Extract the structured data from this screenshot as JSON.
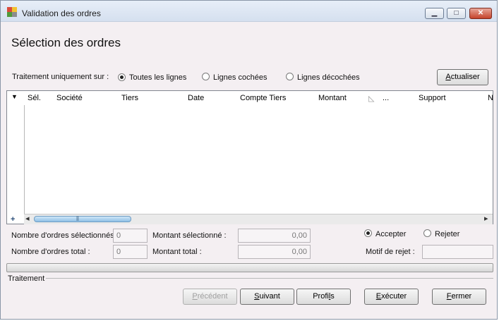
{
  "window": {
    "title": "Validation des ordres",
    "controls": {
      "minimize": "▁",
      "maximize": "□",
      "close": "✕"
    },
    "icon_colors": [
      "#d94b3b",
      "#f2c230",
      "#4f9a3b",
      "#8c8c8c"
    ]
  },
  "page": {
    "heading": "Sélection des ordres"
  },
  "filter": {
    "label": "Traitement uniquement sur :",
    "options": [
      {
        "label": "Toutes les lignes",
        "selected": true
      },
      {
        "label": "Lignes cochées",
        "selected": false
      },
      {
        "label": "Lignes décochées",
        "selected": false
      }
    ],
    "refresh": {
      "pre": "",
      "mnemonic": "A",
      "post": "ctualiser"
    }
  },
  "grid": {
    "menu_glyph": "▼",
    "columns": [
      "Sél.",
      "Société",
      "Tiers",
      "Date",
      "Compte Tiers",
      "Montant",
      "...",
      "Support",
      "N"
    ],
    "sort_glyph": "◺",
    "add_glyph": "+",
    "left_glyph": "◂",
    "right_glyph": "▸",
    "thumb_grip": "⦀"
  },
  "summary": {
    "selected_count": {
      "label": "Nombre d'ordres sélectionnés",
      "value": "0"
    },
    "total_count": {
      "label": "Nombre d'ordres total :",
      "value": "0"
    },
    "selected_amount": {
      "label": "Montant sélectionné :",
      "value": "0,00"
    },
    "total_amount": {
      "label": "Montant total :",
      "value": "0,00"
    },
    "decision": [
      {
        "label": "Accepter",
        "selected": true
      },
      {
        "label": "Rejeter",
        "selected": false
      }
    ],
    "reject_reason": {
      "label": "Motif de rejet :",
      "value": ""
    }
  },
  "processing": {
    "group_label": "Traitement",
    "progress": 0
  },
  "footer": {
    "previous": {
      "pre": "",
      "mnemonic": "P",
      "post": "récédent"
    },
    "next": {
      "pre": "",
      "mnemonic": "S",
      "post": "uivant"
    },
    "profiles": {
      "pre": "Profi",
      "mnemonic": "l",
      "post": "s"
    },
    "execute": {
      "pre": "",
      "mnemonic": "E",
      "post": "xécuter"
    },
    "close": {
      "pre": "",
      "mnemonic": "F",
      "post": "ermer"
    }
  }
}
